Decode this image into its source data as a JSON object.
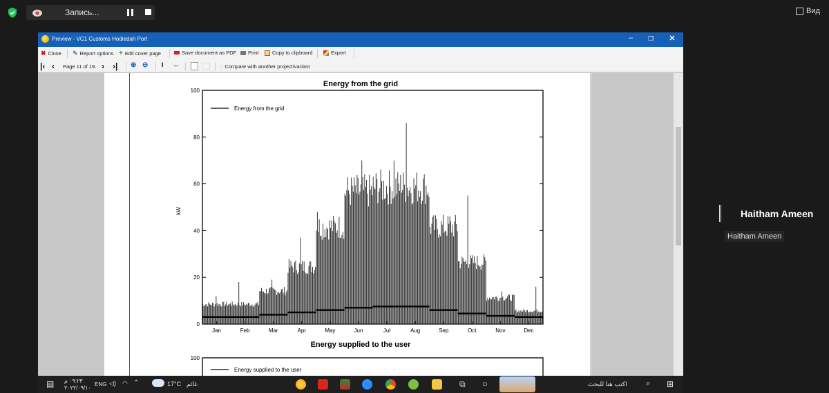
{
  "meeting": {
    "recording_label": "Запись...",
    "view_label": "Вид",
    "participant_name": "Haitham Ameen",
    "participant_tag": "Haitham Ameen"
  },
  "window": {
    "title": "Preview - VC1 Customs Hodiedah Port",
    "toolbar1": {
      "close": "Close",
      "report_options": "Report options",
      "edit_cover": "Edit cover page",
      "save_pdf": "Save document as PDF",
      "print": "Print",
      "copy": "Copy to clipboard",
      "export": "Export"
    },
    "toolbar2": {
      "page_label": "Page 11 of 19.",
      "compare": "Compare with another project/variant"
    }
  },
  "chart_data": [
    {
      "type": "bar",
      "title": "Energy from the grid",
      "ylabel": "kW",
      "xlabel": "",
      "ylim": [
        0,
        100
      ],
      "yticks": [
        0,
        20,
        40,
        60,
        80,
        100
      ],
      "categories": [
        "Jan",
        "Feb",
        "Mar",
        "Apr",
        "May",
        "Jun",
        "Jul",
        "Aug",
        "Sep",
        "Oct",
        "Nov",
        "Dec"
      ],
      "legend": "Energy from the grid",
      "legend_position": "top-left",
      "monthly_typical_peak": [
        9,
        9,
        15,
        26,
        44,
        60,
        62,
        62,
        44,
        28,
        12,
        6
      ],
      "monthly_max_peak": [
        12,
        18,
        19,
        37,
        48,
        70,
        70,
        86,
        46,
        55,
        14,
        16
      ],
      "monthly_baseline": [
        3,
        3,
        4,
        5,
        6,
        7,
        7.5,
        7.5,
        6,
        4.5,
        3.5,
        3
      ]
    },
    {
      "type": "bar",
      "title": "Energy supplied to the user",
      "ylabel": "",
      "xlabel": "",
      "ylim": [
        0,
        100
      ],
      "yticks": [
        100
      ],
      "legend": "Energy supplied to the user",
      "legend_position": "top-left"
    }
  ],
  "taskbar": {
    "time": "٠٩:٢٣ م",
    "date": "٢٠٢٢/٠٩/١٠",
    "lang": "ENG",
    "weather": "17°C",
    "weather_text": "غائم",
    "search_placeholder": "اكتب هنا للبحث"
  }
}
